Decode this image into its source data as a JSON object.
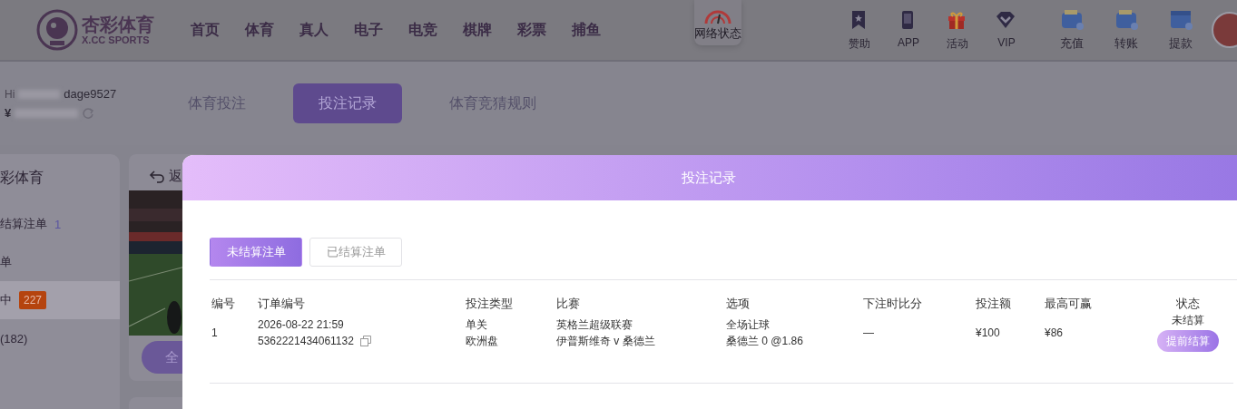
{
  "header": {
    "logo": {
      "name": "杏彩体育",
      "subtitle": "X.CC SPORTS"
    },
    "nav": [
      "首页",
      "体育",
      "真人",
      "电子",
      "电竞",
      "棋牌",
      "彩票",
      "捕鱼"
    ],
    "network_status": "网络状态",
    "actions": [
      {
        "label": "赞助",
        "kind": "bookmark"
      },
      {
        "label": "APP",
        "kind": "phone"
      },
      {
        "label": "活动",
        "kind": "gift"
      },
      {
        "label": "VIP",
        "kind": "diamond"
      }
    ],
    "wallet": [
      {
        "label": "充值",
        "kind": "deposit"
      },
      {
        "label": "转账",
        "kind": "transfer"
      },
      {
        "label": "提款",
        "kind": "withdraw"
      }
    ]
  },
  "user": {
    "greeting": "Hi",
    "username": "dage9527",
    "currency": "¥"
  },
  "tabs": [
    {
      "label": "体育投注",
      "selected": false
    },
    {
      "label": "投注记录",
      "selected": true
    },
    {
      "label": "体育竞猜规则",
      "selected": false
    }
  ],
  "sidebar": {
    "title": "彩体育",
    "items": [
      {
        "label": "结算注单",
        "count": "1",
        "selected": false
      },
      {
        "label": "单",
        "selected": false
      },
      {
        "label": "中",
        "badge": "227",
        "selected": true
      },
      {
        "label": "(182)",
        "selected": false
      }
    ]
  },
  "match_card": {
    "back": "返",
    "button": "全"
  },
  "modal": {
    "title": "投注记录",
    "tabs": [
      {
        "label": "未结算注单",
        "selected": true
      },
      {
        "label": "已结算注单",
        "selected": false
      }
    ],
    "table": {
      "columns": [
        "编号",
        "订单编号",
        "投注类型",
        "比赛",
        "选项",
        "下注时比分",
        "投注额",
        "最高可赢",
        "状态"
      ],
      "rows": [
        {
          "index": "1",
          "time": "2026-08-22 21:59",
          "order_no": "5362221434061132",
          "bet_type": "单关",
          "odds_type": "欧洲盘",
          "league": "英格兰超级联赛",
          "match": "伊普斯维奇 v 桑德兰",
          "market": "全场让球",
          "pick": "桑德兰 0 @1.86",
          "score": "—",
          "stake": "¥100",
          "max_win": "¥86",
          "status": "未结算",
          "action": "提前结算"
        }
      ]
    }
  }
}
